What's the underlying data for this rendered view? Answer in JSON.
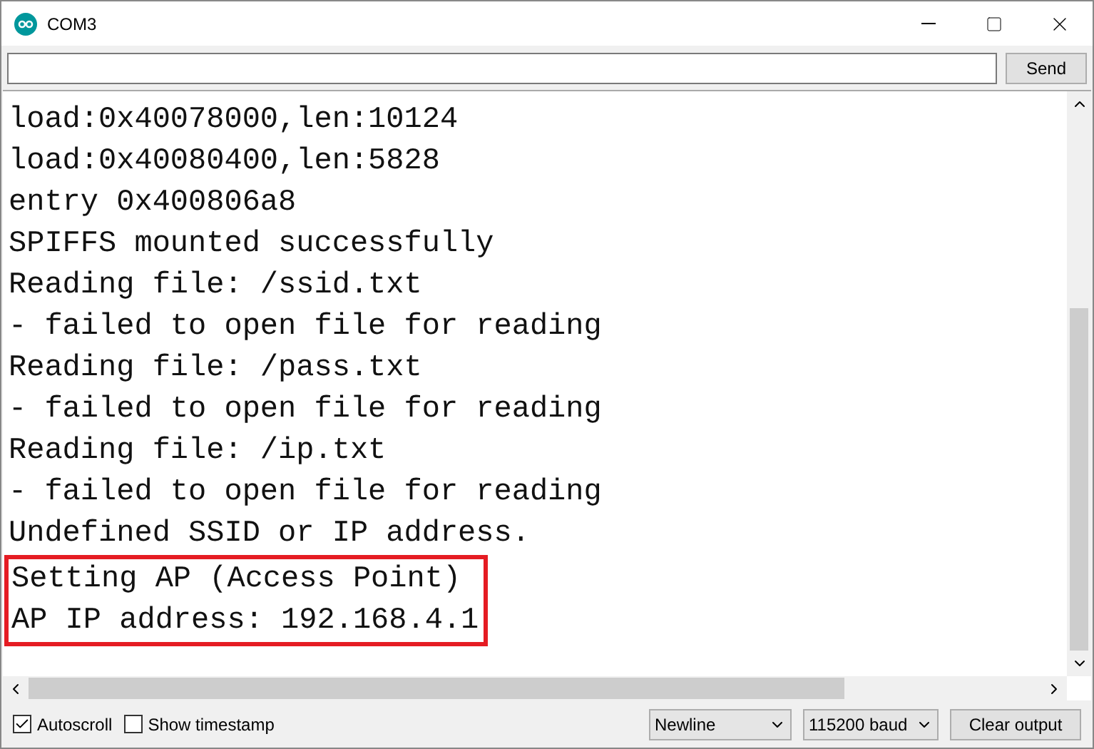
{
  "window": {
    "title": "COM3"
  },
  "input": {
    "button": "Send"
  },
  "output": {
    "lines": [
      "load:0x40078000,len:10124",
      "load:0x40080400,len:5828",
      "entry 0x400806a8",
      "SPIFFS mounted successfully",
      "Reading file: /ssid.txt",
      "- failed to open file for reading",
      "Reading file: /pass.txt",
      "- failed to open file for reading",
      "Reading file: /ip.txt",
      "- failed to open file for reading",
      "Undefined SSID or IP address."
    ],
    "highlighted_lines": [
      "Setting AP (Access Point)",
      "AP IP address: 192.168.4.1"
    ]
  },
  "status_bar": {
    "autoscroll": {
      "label": "Autoscroll",
      "checked": true
    },
    "timestamp": {
      "label": "Show timestamp",
      "checked": false
    },
    "line_ending": "Newline",
    "baud": "115200 baud",
    "clear": "Clear output"
  }
}
